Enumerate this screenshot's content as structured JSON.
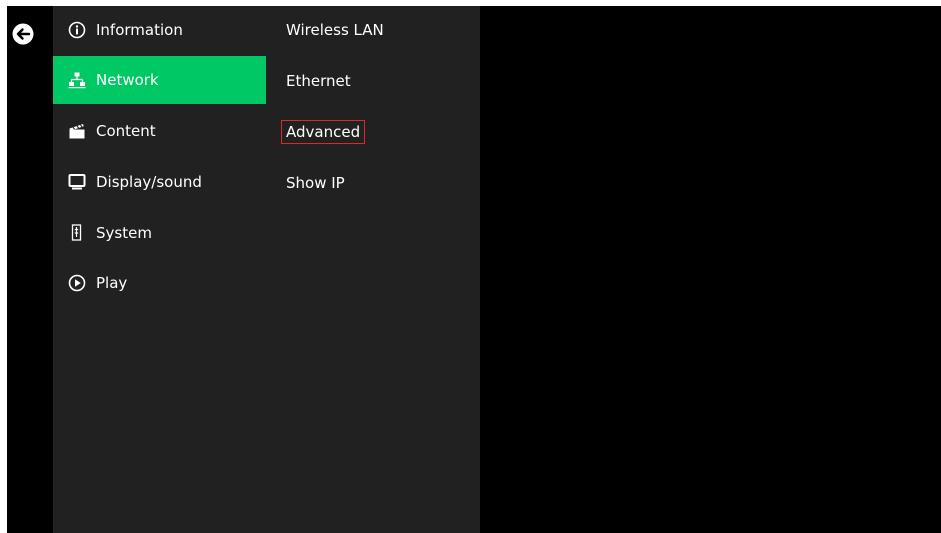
{
  "back_icon": "arrow-left-circle-icon",
  "menu": [
    {
      "label": "Information",
      "icon": "info-circle-icon"
    },
    {
      "label": "Network",
      "icon": "network-icon",
      "selected": true
    },
    {
      "label": "Content",
      "icon": "clapperboard-icon"
    },
    {
      "label": "Display/sound",
      "icon": "monitor-icon"
    },
    {
      "label": "System",
      "icon": "system-icon"
    },
    {
      "label": "Play",
      "icon": "play-circle-icon"
    }
  ],
  "submenu": [
    {
      "label": "Wireless LAN"
    },
    {
      "label": "Ethernet"
    },
    {
      "label": "Advanced",
      "highlighted": true
    },
    {
      "label": "Show IP"
    }
  ],
  "colors": {
    "selected": "#00c864",
    "panel": "#212121",
    "background": "#000000",
    "highlight_border": "#d9292b"
  }
}
